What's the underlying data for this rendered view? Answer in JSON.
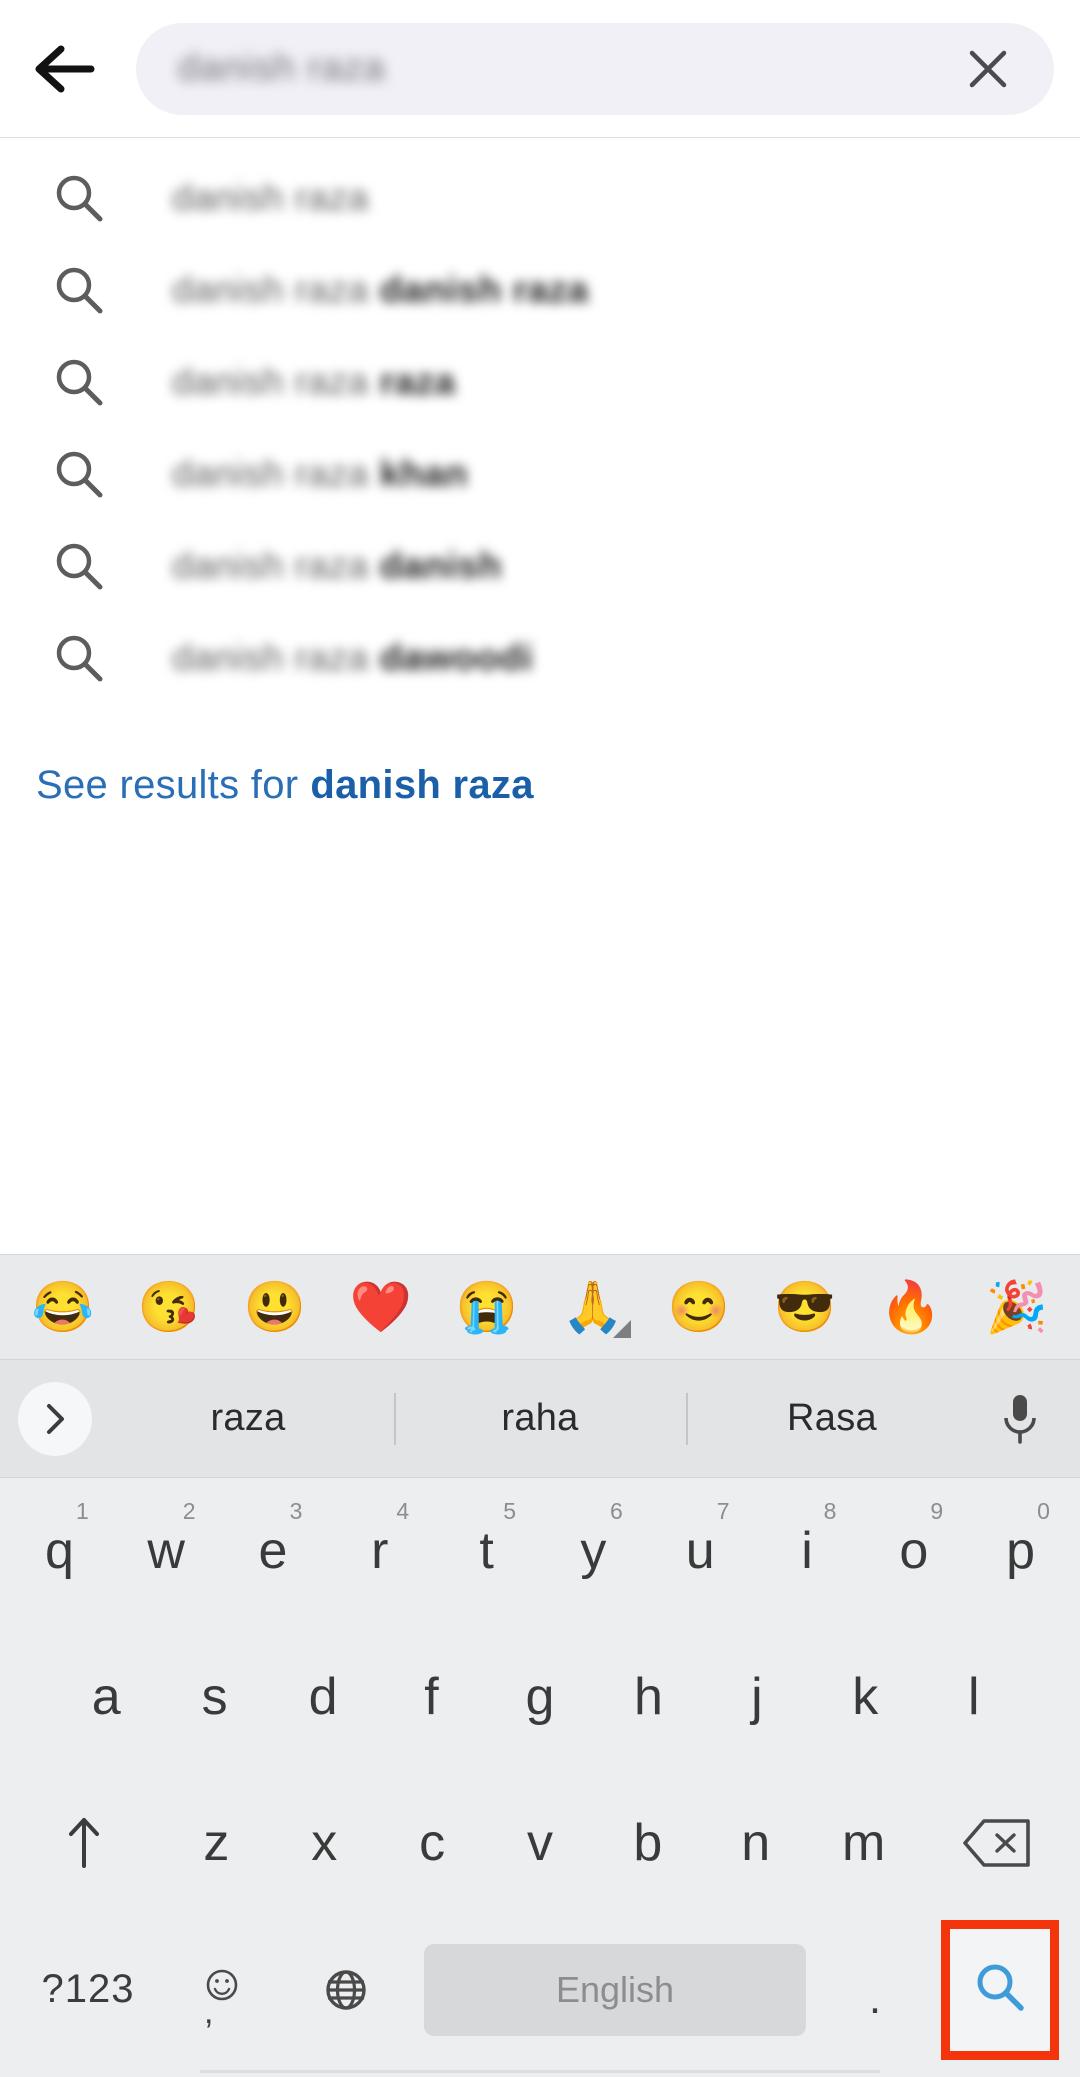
{
  "topbar": {
    "back_icon": "back-arrow-icon",
    "query_value": "danish raza",
    "clear_icon": "close-icon"
  },
  "suggestions": {
    "icon": "search-icon",
    "items": [
      {
        "prefix": "danish raza",
        "bold": ""
      },
      {
        "prefix": "danish raza ",
        "bold": "danish raza"
      },
      {
        "prefix": "danish raza ",
        "bold": "raza"
      },
      {
        "prefix": "danish raza ",
        "bold": "khan"
      },
      {
        "prefix": "danish raza ",
        "bold": "danish"
      },
      {
        "prefix": "danish raza ",
        "bold": "dawoodi"
      }
    ],
    "see_results_prefix": "See results for",
    "see_results_query": "danish raza",
    "link_color": "#2a6fb5"
  },
  "keyboard": {
    "emoji_row": [
      {
        "glyph": "😂",
        "name": "face-with-tears-of-joy-emoji"
      },
      {
        "glyph": "😘",
        "name": "face-blowing-a-kiss-emoji"
      },
      {
        "glyph": "😃",
        "name": "grinning-face-with-big-eyes-emoji"
      },
      {
        "glyph": "❤️",
        "name": "red-heart-emoji"
      },
      {
        "glyph": "😭",
        "name": "loudly-crying-face-emoji"
      },
      {
        "glyph": "🙏",
        "name": "folded-hands-emoji"
      },
      {
        "glyph": "😊",
        "name": "smiling-face-with-smiling-eyes-emoji"
      },
      {
        "glyph": "😎",
        "name": "smiling-face-with-sunglasses-emoji"
      },
      {
        "glyph": "🔥",
        "name": "fire-emoji"
      },
      {
        "glyph": "🎉",
        "name": "party-popper-emoji"
      }
    ],
    "expand_icon": "chevron-right-icon",
    "candidates": [
      "raza",
      "raha",
      "Rasa"
    ],
    "mic_icon": "microphone-icon",
    "row1": [
      {
        "key": "q",
        "num": "1"
      },
      {
        "key": "w",
        "num": "2"
      },
      {
        "key": "e",
        "num": "3"
      },
      {
        "key": "r",
        "num": "4"
      },
      {
        "key": "t",
        "num": "5"
      },
      {
        "key": "y",
        "num": "6"
      },
      {
        "key": "u",
        "num": "7"
      },
      {
        "key": "i",
        "num": "8"
      },
      {
        "key": "o",
        "num": "9"
      },
      {
        "key": "p",
        "num": "0"
      }
    ],
    "row2": [
      "a",
      "s",
      "d",
      "f",
      "g",
      "h",
      "j",
      "k",
      "l"
    ],
    "row3": [
      "z",
      "x",
      "c",
      "v",
      "b",
      "n",
      "m"
    ],
    "shift_icon": "shift-arrow-icon",
    "backspace_icon": "backspace-icon",
    "numeric_label": "?123",
    "emoji_key_icon": "emoji-smiley-icon",
    "comma_label": ",",
    "globe_icon": "globe-language-icon",
    "space_label": "English",
    "period_label": ".",
    "enter_icon": "search-enter-icon",
    "enter_icon_color": "#3f9bd9",
    "highlight_color": "#f4350c"
  }
}
